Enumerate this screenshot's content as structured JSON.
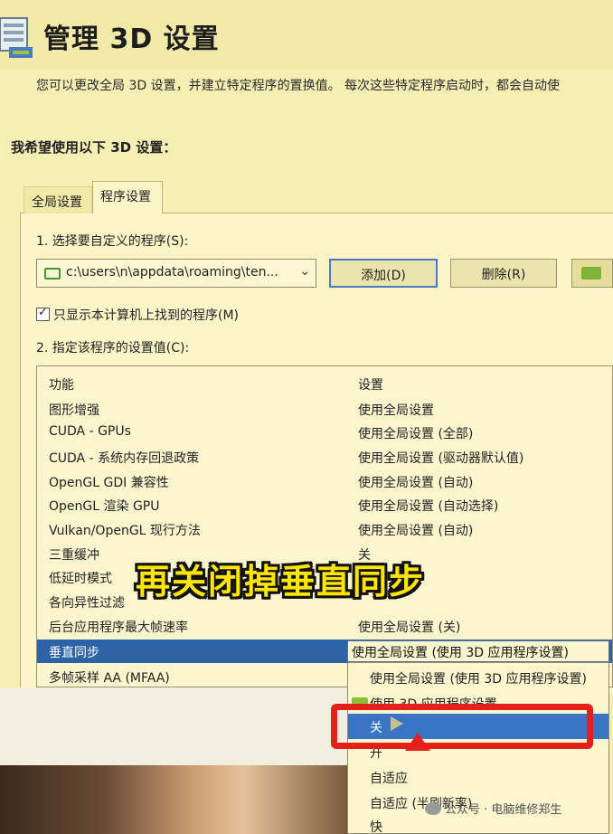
{
  "window": {
    "title": "管理 3D 设置",
    "description": "您可以更改全局 3D 设置，并建立特定程序的置换值。 每次这些特定程序启动时，都会自动使",
    "section_label": "我希望使用以下 3D 设置："
  },
  "tabs": [
    {
      "label": "全局设置",
      "active": false
    },
    {
      "label": "程序设置",
      "active": true
    }
  ],
  "program": {
    "step1_label": "1. 选择要自定义的程序(S):",
    "selected_path": "c:\\users\\n\\appdata\\roaming\\ten...",
    "add_button": "添加(D)",
    "remove_button": "删除(R)",
    "checkbox_label": "只显示本计算机上找到的程序(M)",
    "checkbox_checked": true
  },
  "settings": {
    "step2_label": "2. 指定该程序的设置值(C):",
    "columns": [
      "功能",
      "设置"
    ],
    "rows": [
      {
        "feature": "图形增强",
        "value": "使用全局设置"
      },
      {
        "feature": "CUDA - GPUs",
        "value": "使用全局设置 (全部)"
      },
      {
        "feature": "CUDA - 系统内存回退政策",
        "value": "使用全局设置 (驱动器默认值)"
      },
      {
        "feature": "OpenGL GDI 兼容性",
        "value": "使用全局设置 (自动)"
      },
      {
        "feature": "OpenGL 渲染 GPU",
        "value": "使用全局设置 (自动选择)"
      },
      {
        "feature": "Vulkan/OpenGL 现行方法",
        "value": "使用全局设置 (自动)"
      },
      {
        "feature": "三重缓冲",
        "value": "关"
      },
      {
        "feature": "低延时模式",
        "value": ""
      },
      {
        "feature": "各向异性过滤",
        "value": ""
      },
      {
        "feature": "后台应用程序最大帧速率",
        "value": "使用全局设置 (关)"
      },
      {
        "feature": "垂直同步",
        "value": "",
        "selected": true
      },
      {
        "feature": "多帧采样 AA (MFAA)",
        "value": ""
      }
    ]
  },
  "dropdown": {
    "current": "使用全局设置 (使用 3D 应用程序设置)",
    "options": [
      {
        "label": "使用全局设置 (使用 3D 应用程序设置)",
        "icon": ""
      },
      {
        "label": "使用 3D 应用程序设置",
        "icon": "nvidia-icon"
      },
      {
        "label": "关",
        "highlighted": true
      },
      {
        "label": "开"
      },
      {
        "label": "自适应"
      },
      {
        "label": "自适应 (半刷新率)"
      },
      {
        "label": "快"
      }
    ]
  },
  "overlay": {
    "caption": "再关闭掉垂直同步",
    "caption_color": "#ffe500",
    "highlight_color": "#e5201b"
  },
  "watermark": "公众号 · 电脑维修郑生"
}
